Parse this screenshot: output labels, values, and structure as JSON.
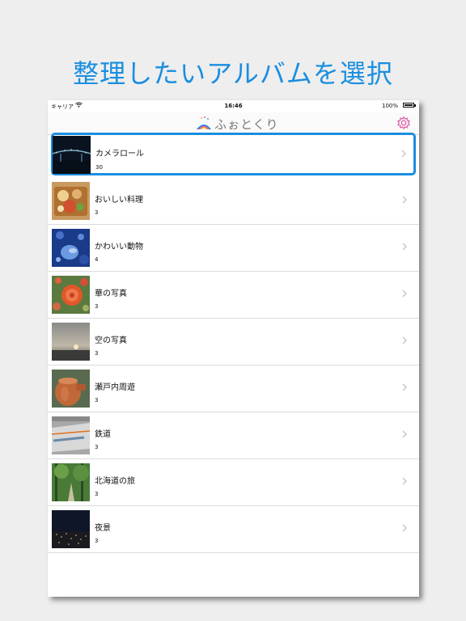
{
  "headline": "整理したいアルバムを選択",
  "status_bar": {
    "carrier": "キャリア",
    "time": "16:46",
    "battery": "100%"
  },
  "nav": {
    "logo_text": "ふぉとくり",
    "settings_icon": "gear-icon"
  },
  "colors": {
    "accent": "#1a8ee0",
    "gear": "#e05aa8"
  },
  "albums": [
    {
      "title": "カメラロール",
      "count": "30",
      "selected": true,
      "thumb": "night-bridge"
    },
    {
      "title": "おいしい料理",
      "count": "3",
      "thumb": "bento"
    },
    {
      "title": "かわいい動物",
      "count": "4",
      "thumb": "blue-animal"
    },
    {
      "title": "華の写真",
      "count": "3",
      "thumb": "rose"
    },
    {
      "title": "空の写真",
      "count": "3",
      "thumb": "sunset-sky"
    },
    {
      "title": "瀬戸内周遊",
      "count": "3",
      "thumb": "clay-pot"
    },
    {
      "title": "鉄道",
      "count": "3",
      "thumb": "train"
    },
    {
      "title": "北海道の旅",
      "count": "3",
      "thumb": "forest-path"
    },
    {
      "title": "夜景",
      "count": "3",
      "thumb": "night-city"
    }
  ]
}
